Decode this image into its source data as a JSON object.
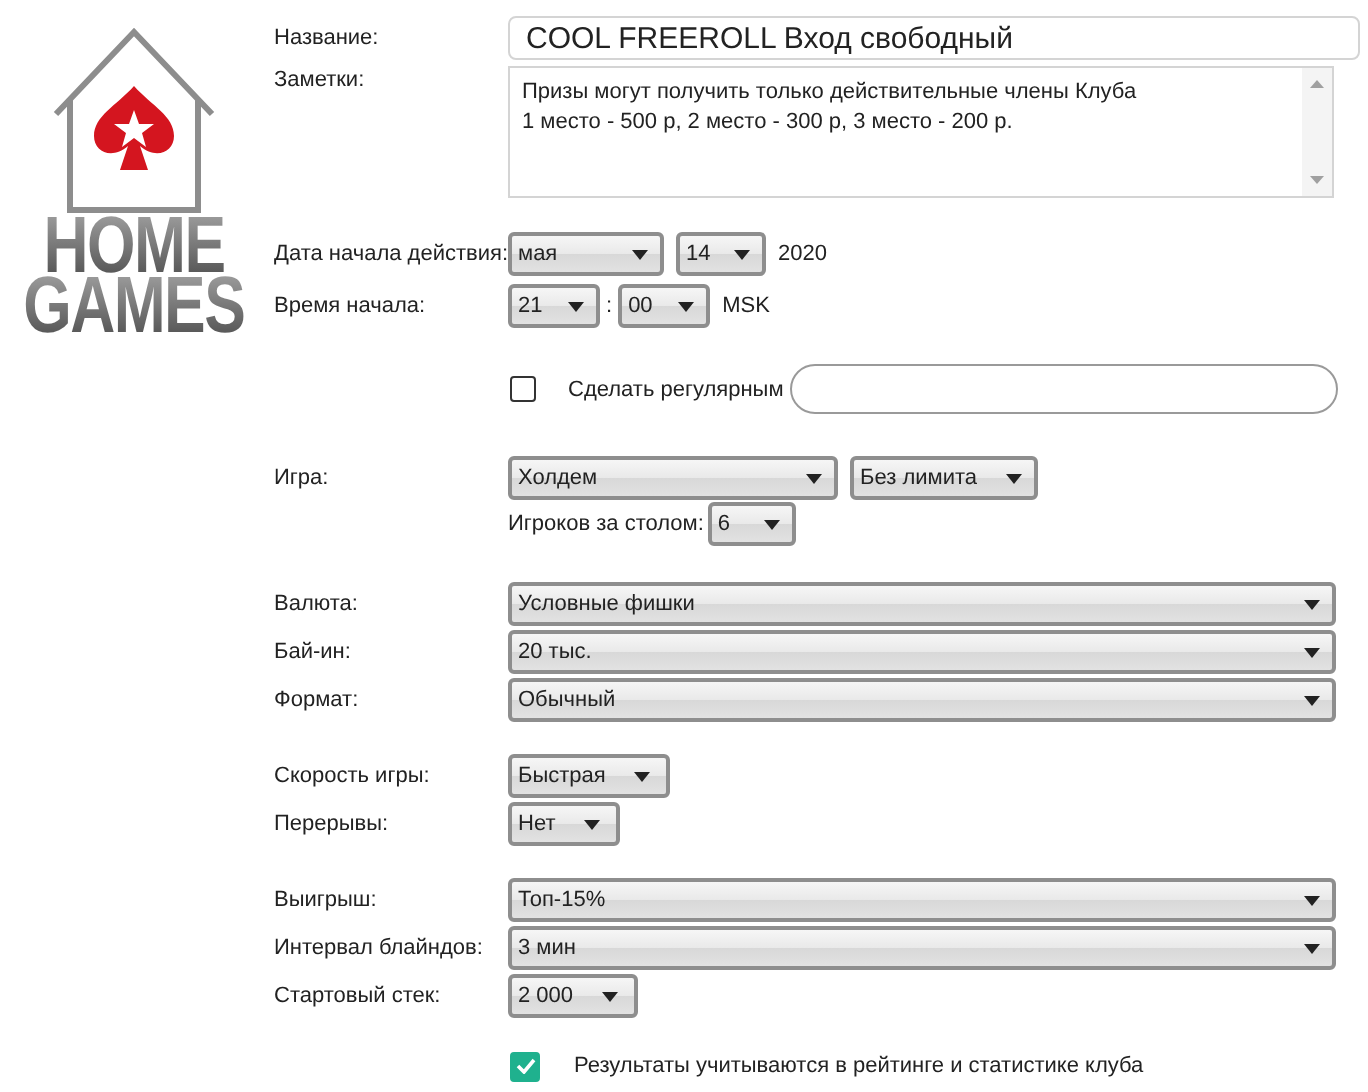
{
  "logo": {
    "line1": "HOME",
    "line2": "GAMES"
  },
  "name": {
    "label": "Название:",
    "value": "COOL FREEROLL Вход свободный"
  },
  "notes": {
    "label": "Заметки:",
    "lines": [
      "Призы могут получить только действительные члены Клуба",
      "1 место - 500 р, 2 место - 300 р, 3 место - 200 р."
    ]
  },
  "start_date": {
    "label": "Дата начала действия:",
    "month": "мая",
    "day": "14",
    "year": "2020"
  },
  "start_time": {
    "label": "Время начала:",
    "hour": "21",
    "separator": ":",
    "minute": "00",
    "zone": "MSK"
  },
  "recurring": {
    "label": "Сделать регулярным",
    "checked": false
  },
  "game": {
    "label": "Игра:",
    "type": "Холдем",
    "limit": "Без лимита",
    "players_label": "Игроков за столом:",
    "players": "6"
  },
  "settings": [
    [
      {
        "label": "Валюта:",
        "value": "Условные фишки",
        "kind": "wide"
      },
      {
        "label": "Бай-ин:",
        "value": "20 тыс.",
        "kind": "wide"
      },
      {
        "label": "Формат:",
        "value": "Обычный",
        "kind": "wide"
      }
    ],
    [
      {
        "label": "Скорость игры:",
        "value": "Быстрая",
        "kind": "compact"
      },
      {
        "label": "Перерывы:",
        "value": "Нет",
        "kind": "compact"
      }
    ],
    [
      {
        "label": "Выигрыш:",
        "value": "Топ-15%",
        "kind": "wide"
      },
      {
        "label": "Интервал блайндов:",
        "value": "3 мин",
        "kind": "wide"
      },
      {
        "label": "Стартовый стек:",
        "value": "2 000",
        "kind": "compact"
      }
    ]
  ],
  "results": {
    "label": "Результаты учитываются в рейтинге и статистике клуба",
    "checked": true
  }
}
